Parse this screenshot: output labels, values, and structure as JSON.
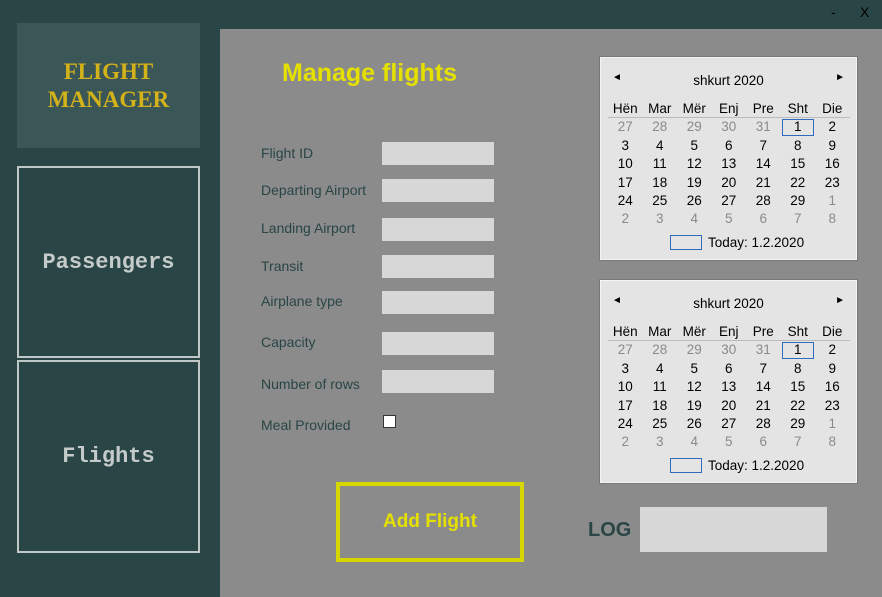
{
  "window": {
    "minimize_label": "-",
    "close_label": "X"
  },
  "sidebar": {
    "logo_text": "FLIGHT\nMANAGER",
    "nav": [
      {
        "label": "Passengers"
      },
      {
        "label": "Flights"
      }
    ]
  },
  "main": {
    "title": "Manage flights",
    "fields": [
      {
        "label": "Flight ID",
        "value": ""
      },
      {
        "label": "Departing Airport",
        "value": ""
      },
      {
        "label": "Landing Airport",
        "value": ""
      },
      {
        "label": "Transit",
        "value": ""
      },
      {
        "label": "Airplane type",
        "value": ""
      },
      {
        "label": "Capacity",
        "value": ""
      },
      {
        "label": "Number of rows",
        "value": ""
      }
    ],
    "meal": {
      "label": "Meal Provided",
      "checked": false
    },
    "add_button_label": "Add Flight",
    "log_label": "LOG",
    "log_value": ""
  },
  "calendars": [
    {
      "prev_icon": "◄",
      "next_icon": "►",
      "month_label": "shkurt 2020",
      "day_names": [
        "Hën",
        "Mar",
        "Mër",
        "Enj",
        "Pre",
        "Sht",
        "Die"
      ],
      "weeks": [
        [
          "27",
          "28",
          "29",
          "30",
          "31",
          "1",
          "2"
        ],
        [
          "3",
          "4",
          "5",
          "6",
          "7",
          "8",
          "9"
        ],
        [
          "10",
          "11",
          "12",
          "13",
          "14",
          "15",
          "16"
        ],
        [
          "17",
          "18",
          "19",
          "20",
          "21",
          "22",
          "23"
        ],
        [
          "24",
          "25",
          "26",
          "27",
          "28",
          "29",
          "1"
        ],
        [
          "2",
          "3",
          "4",
          "5",
          "6",
          "7",
          "8"
        ]
      ],
      "selected": "1",
      "today_label": "Today: 1.2.2020"
    },
    {
      "prev_icon": "◄",
      "next_icon": "►",
      "month_label": "shkurt 2020",
      "day_names": [
        "Hën",
        "Mar",
        "Mër",
        "Enj",
        "Pre",
        "Sht",
        "Die"
      ],
      "weeks": [
        [
          "27",
          "28",
          "29",
          "30",
          "31",
          "1",
          "2"
        ],
        [
          "3",
          "4",
          "5",
          "6",
          "7",
          "8",
          "9"
        ],
        [
          "10",
          "11",
          "12",
          "13",
          "14",
          "15",
          "16"
        ],
        [
          "17",
          "18",
          "19",
          "20",
          "21",
          "22",
          "23"
        ],
        [
          "24",
          "25",
          "26",
          "27",
          "28",
          "29",
          "1"
        ],
        [
          "2",
          "3",
          "4",
          "5",
          "6",
          "7",
          "8"
        ]
      ],
      "selected": "1",
      "today_label": "Today: 1.2.2020"
    }
  ],
  "colors": {
    "sidebar_bg": "#2a4545",
    "panel_bg": "#8b8b8b",
    "accent": "#e5e000",
    "logo_gold": "#d4b31a"
  }
}
